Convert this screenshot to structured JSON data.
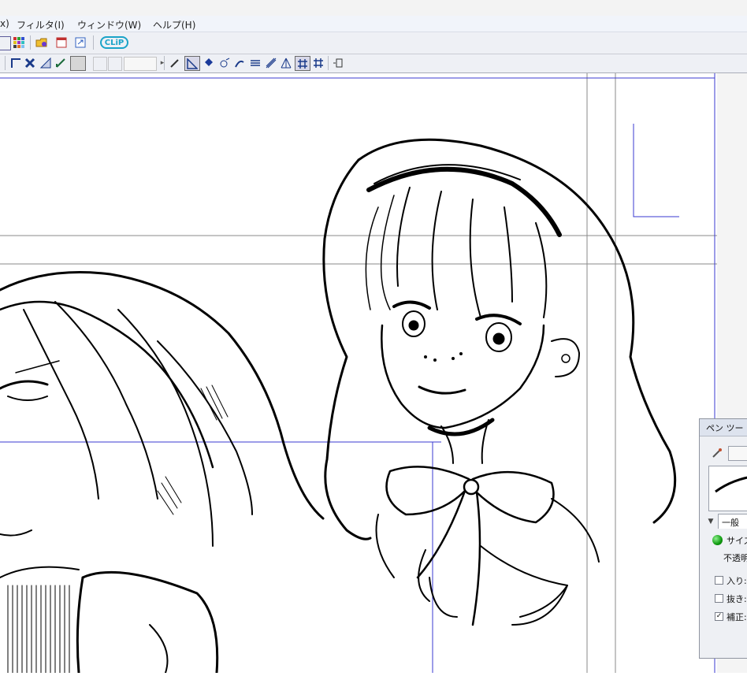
{
  "menu": {
    "items": [
      "x)",
      "フィルタ(I)",
      "ウィンドウ(W)",
      "ヘルプ(H)"
    ]
  },
  "toolbar": {
    "clip_label": "CLiP"
  },
  "pen_panel": {
    "title": "ペン ツー",
    "tab_label": "一般",
    "size_label": "サイズ",
    "opacity_label": "不透明",
    "start_label": "入り:",
    "end_label": "抜き:",
    "correction_label": "補正:"
  },
  "colors": {
    "menubar_bg": "#f1f4fa",
    "toolbar_bg": "#eef0f5",
    "guide_blue": "#3a3ad0",
    "guide_gray": "#8a8a8a",
    "accent_clip": "#1aa3c8"
  },
  "icons": [
    "layer-icon",
    "palette-icon",
    "folder-icon",
    "window-icon",
    "export-icon",
    "clip-studio-icon",
    "ruler-icon",
    "transform-icon",
    "perspective-icon",
    "pen-icon",
    "triangle-ruler-icon",
    "eraser-icon",
    "grid-icon"
  ]
}
